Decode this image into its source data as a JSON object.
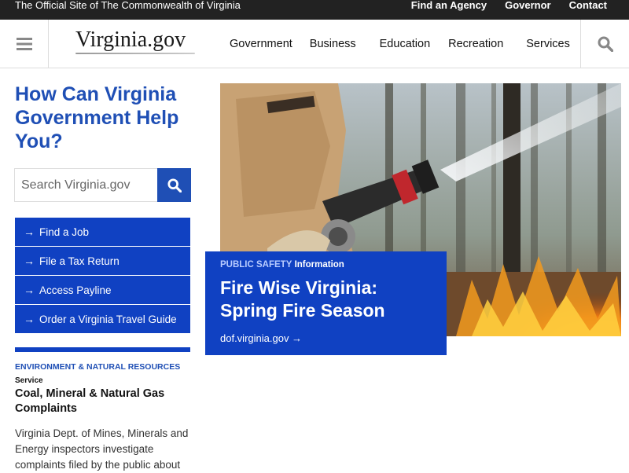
{
  "topbar": {
    "official_text": "The Official Site of The Commonwealth of Virginia",
    "links": [
      "Find an Agency",
      "Governor",
      "Contact"
    ]
  },
  "header": {
    "menu_icon": "hamburger-icon",
    "logo_text": "Virginia.gov",
    "nav": [
      "Government",
      "Business",
      "Education",
      "Recreation",
      "Services"
    ],
    "search_icon": "search-icon"
  },
  "sidebar": {
    "heading": "How Can Virginia Government Help You?",
    "search": {
      "placeholder": "Search Virginia.gov",
      "value": ""
    },
    "quick_links": [
      {
        "label": "Find a Job"
      },
      {
        "label": "File a Tax Return"
      },
      {
        "label": "Access Payline"
      },
      {
        "label": "Order a Virginia Travel Guide"
      }
    ],
    "arrow": "→"
  },
  "feature": {
    "category": "ENVIRONMENT & NATURAL RESOURCES",
    "type": "Service",
    "title": "Coal, Mineral & Natural Gas Complaints",
    "body": "Virginia Dept. of Mines, Minerals and Energy inspectors investigate complaints filed by the public about"
  },
  "hero": {
    "category": "PUBLIC SAFETY",
    "type": "Information",
    "title": "Fire Wise Virginia: Spring Fire Season",
    "link": "dof.virginia.gov →"
  },
  "colors": {
    "brand_blue": "#1041c2",
    "heading_blue": "#1f4fb5",
    "topbar": "#222222"
  }
}
